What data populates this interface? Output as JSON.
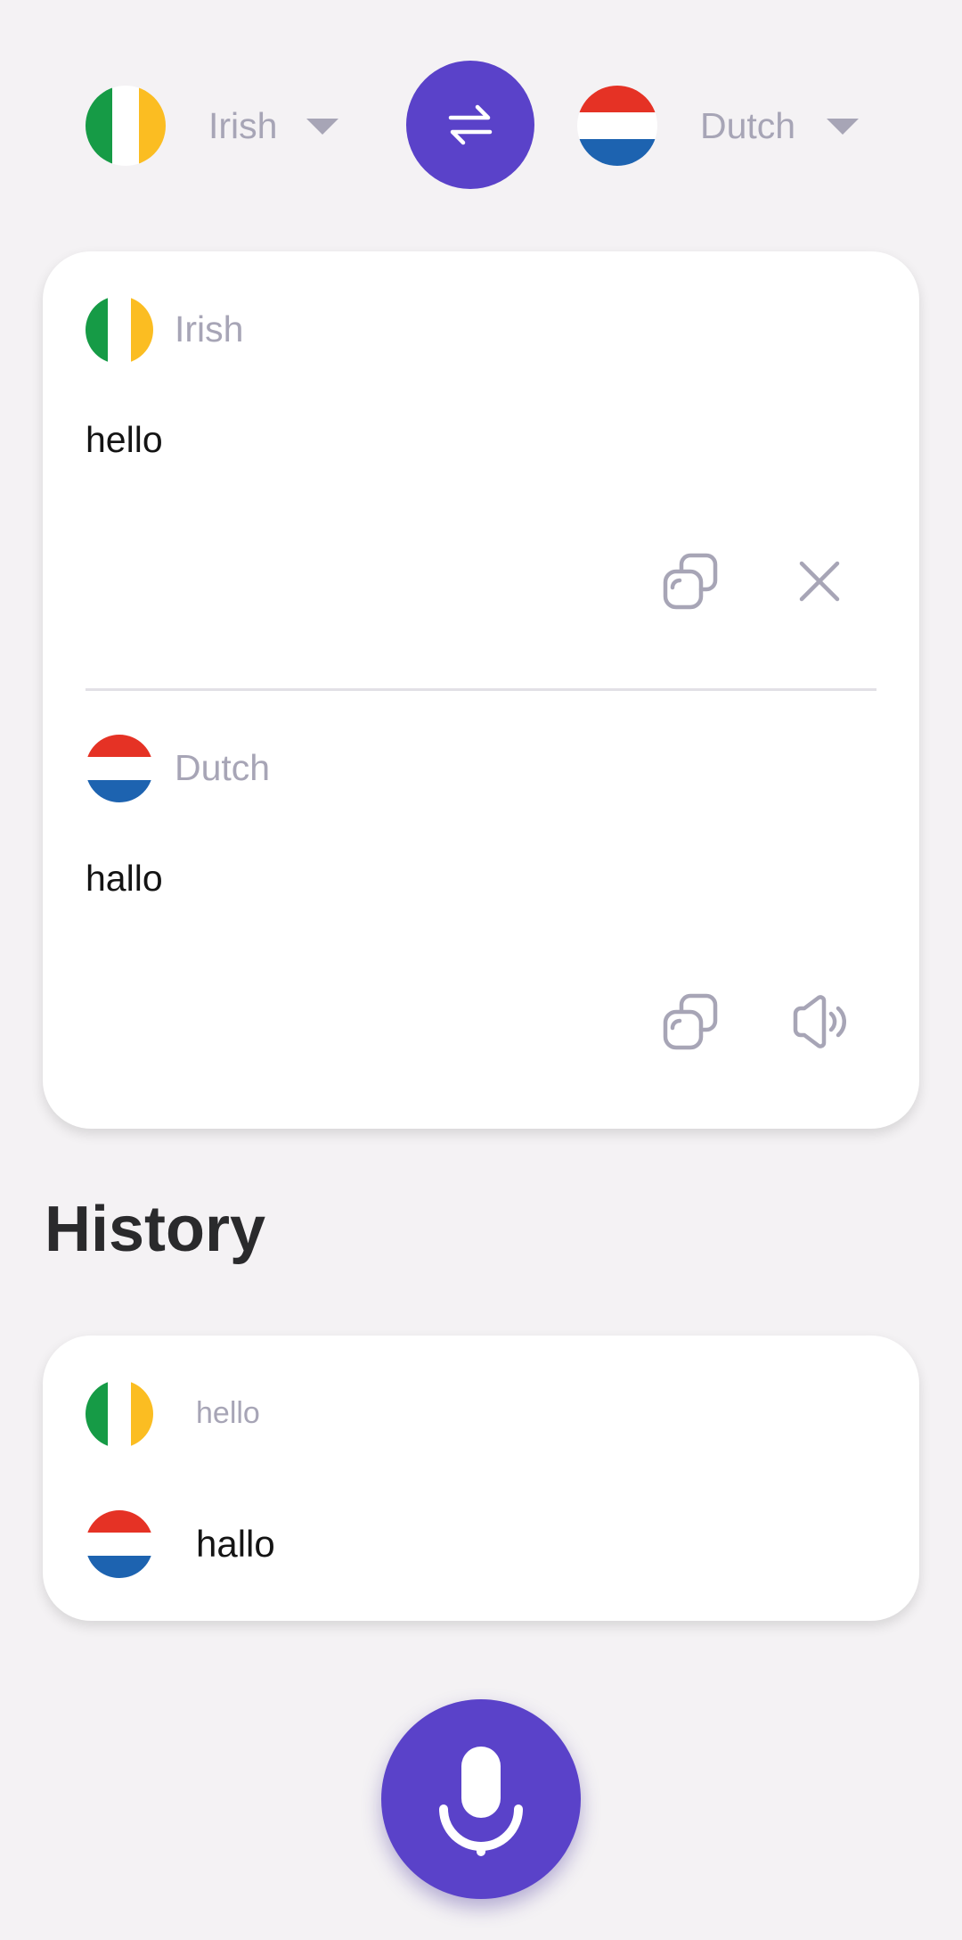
{
  "header": {
    "source_language": "Irish",
    "target_language": "Dutch"
  },
  "translation_card": {
    "source": {
      "language": "Irish",
      "text": "hello"
    },
    "target": {
      "language": "Dutch",
      "text": "hallo"
    }
  },
  "history": {
    "title": "History",
    "items": [
      {
        "source_text": "hello",
        "target_text": "hallo"
      }
    ]
  },
  "colors": {
    "accent": "#5a42c9",
    "muted_text": "#a7a5b6",
    "background": "#f4f2f4",
    "ireland_green": "#169b46",
    "ireland_white": "#ffffff",
    "ireland_orange": "#fbbd22",
    "netherlands_red": "#e53225",
    "netherlands_white": "#ffffff",
    "netherlands_blue": "#1d63b0"
  },
  "icons": {
    "swap": "swap-arrows-icon",
    "copy": "copy-icon",
    "clear": "close-icon",
    "speak": "speaker-icon",
    "mic": "microphone-icon"
  }
}
